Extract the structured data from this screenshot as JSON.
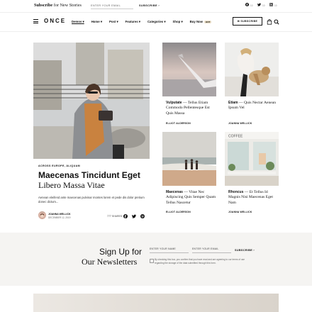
{
  "topbar": {
    "subscribe_bold": "Subscribe",
    "subscribe_rest": " for New Stories",
    "email_placeholder": "ENTER YOUR EMAIL",
    "subscribe_button": "SUBSCRIBE",
    "facebook_count": "10",
    "twitter_count": "10",
    "instagram_count": "10"
  },
  "nav": {
    "logo": "ONCE",
    "items": [
      {
        "label": "Demos",
        "active": true
      },
      {
        "label": "Home"
      },
      {
        "label": "Post"
      },
      {
        "label": "Features"
      },
      {
        "label": "Categories"
      },
      {
        "label": "Shop"
      },
      {
        "label": "Buy Now",
        "badge": "HOT"
      }
    ],
    "subscribe_button": "SUBSCRIBE"
  },
  "hero": {
    "categories": "ACROSS EUROPE,  ALIQUAM",
    "title_line1": "Maecenas Tincidunt Eget",
    "title_line2": "Libero Massa Vitae",
    "excerpt": "Aenean eleifend ante maecenas pulvinar montes lorem et pede dis dolor pretium donec dictum...",
    "author": "JOANNA WELLICK",
    "date": "DECEMBER 12, 2019",
    "shares": "777 SHARES"
  },
  "cards": [
    {
      "title_bold": "Vulputate",
      "title_rest": " — Tellus Etiam Commodo Pellentesque Est Quis Massa",
      "author": "ELLIOT ALDERSON"
    },
    {
      "title_bold": "Etiam",
      "title_rest": " — Quis Nectar Aenean Ipsum Vel",
      "author": "JOANNA WELLICK"
    },
    {
      "title_bold": "Maecenas",
      "title_rest": " — Vitae Nec Adipiscing Quis Semper Quam Tellus Nascetur",
      "author": "ELLIOT ALDERSON"
    },
    {
      "title_bold": "Rhoncus",
      "title_rest": " — Et Tellus Id Magnis Nisi Maecenas Eget Nam",
      "author": "JOANNA WELLICK"
    }
  ],
  "newsletter": {
    "title_line1": "Sign Up for",
    "title_line2": "Our Newsletters",
    "name_placeholder": "ENTER YOUR NAME",
    "email_placeholder": "ENTER YOUR EMAIL",
    "subscribe_button": "SUBSCRIBE",
    "consent": "By checking this box, you confirm that you have read and are agreeing to our terms of use regarding the storage of the data submitted through this form."
  },
  "colors": {
    "accent": "#e8dcc4",
    "newsletter_bg": "#f5f4f2"
  }
}
